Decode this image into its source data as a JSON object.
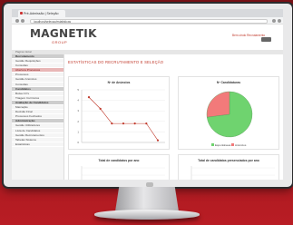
{
  "browser": {
    "tab_title": "Pré-Admissão | Seleção",
    "url": "localhost/selecao/estatisticas"
  },
  "header": {
    "logo": "MAGNETIK",
    "logo_sub": "GROUP",
    "top_link": "Bem-vindo Recrutamento"
  },
  "breadcrumb": "Página inicial",
  "sidebar": {
    "items": [
      {
        "label": "Recrutamento",
        "kind": "section"
      },
      {
        "label": "Gestão Requisições",
        "kind": "item"
      },
      {
        "label": "Consultas",
        "kind": "item"
      },
      {
        "label": "Abertura Processos",
        "kind": "active"
      },
      {
        "label": "Processos",
        "kind": "item"
      },
      {
        "label": "Gestão Anúncios",
        "kind": "item"
      },
      {
        "label": "Consultas",
        "kind": "item"
      },
      {
        "label": "Candidatos",
        "kind": "section"
      },
      {
        "label": "Bolsa CV's",
        "kind": "item"
      },
      {
        "label": "Triagem Currículos",
        "kind": "item"
      },
      {
        "label": "Avaliação de Candidatos",
        "kind": "section"
      },
      {
        "label": "Marcação",
        "kind": "item"
      },
      {
        "label": "Decisão Final",
        "kind": "item"
      },
      {
        "label": "Processos Fechados",
        "kind": "item"
      },
      {
        "label": "Administração",
        "kind": "section"
      },
      {
        "label": "Gestão Utilizadores",
        "kind": "item"
      },
      {
        "label": "Lista de Candidatos",
        "kind": "item"
      },
      {
        "label": "Gestão Recrutamentos",
        "kind": "item"
      },
      {
        "label": "Tabelas Sistema",
        "kind": "item"
      },
      {
        "label": "Estatísticas",
        "kind": "item"
      }
    ]
  },
  "main": {
    "title": "ESTATÍSTICAS DO RECRUTAMENTO E SELEÇÃO"
  },
  "line_panel": {
    "title": "Nº de Anúncios"
  },
  "pie_panel": {
    "title": "Nº Candidaturas"
  },
  "bottom_left_panel": {
    "title": "Total de candidatos por ano"
  },
  "bottom_right_panel": {
    "title": "Total de candidatos presenciados por ano"
  },
  "chart_data": [
    {
      "type": "line",
      "title": "Nº de Anúncios",
      "categories": [
        "",
        "",
        "",
        "",
        "",
        "",
        ""
      ],
      "series": [
        {
          "values": [
            4.3,
            3.2,
            1.8,
            1.8,
            1.8,
            1.8,
            0.2
          ]
        }
      ],
      "ylim": [
        0,
        5
      ],
      "yticks": [
        "5",
        "4",
        "3",
        "2",
        "1",
        "0"
      ],
      "grid": true,
      "color": "#c0392b"
    },
    {
      "type": "pie",
      "title": "Nº Candidaturas",
      "slices": [
        {
          "label": "Espontâneas",
          "value": 73,
          "color": "#6fd36f"
        },
        {
          "label": "Anúncios",
          "value": 27,
          "color": "#f27a7a"
        }
      ],
      "legend": "bottom"
    }
  ],
  "colors": {
    "brand": "#c0392b",
    "background": "#b51b22"
  }
}
